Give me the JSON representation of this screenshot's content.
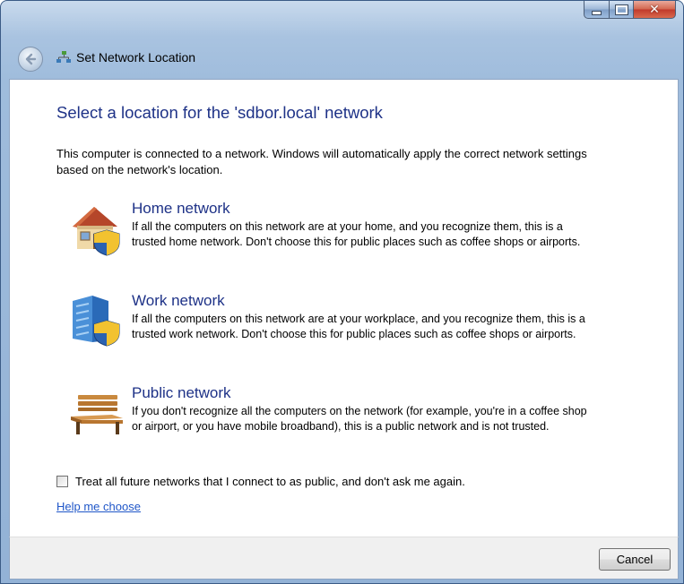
{
  "window": {
    "title": "Set Network Location",
    "caption_buttons": {
      "minimize": "minimize-icon",
      "maximize": "maximize-icon",
      "close": "close-icon"
    }
  },
  "heading": "Select a location for the 'sdbor.local' network",
  "intro": "This computer is connected to a network. Windows will automatically apply the correct network settings based on the network's location.",
  "options": [
    {
      "title": "Home network",
      "description": "If all the computers on this network are at your home, and you recognize them, this is a trusted home network.  Don't choose this for public places such as coffee shops or airports.",
      "icon": "home-network-icon"
    },
    {
      "title": "Work network",
      "description": "If all the computers on this network are at your workplace, and you recognize them, this is a trusted work network.  Don't choose this for public places such as coffee shops or airports.",
      "icon": "work-network-icon"
    },
    {
      "title": "Public network",
      "description": "If you don't recognize all the computers on the network (for example, you're in a coffee shop or airport, or you have mobile broadband), this is a public network and is not trusted.",
      "icon": "public-network-icon"
    }
  ],
  "checkbox": {
    "label": "Treat all future networks that I connect to as public, and don't ask me again.",
    "checked": false
  },
  "help_link": "Help me choose",
  "footer": {
    "cancel_label": "Cancel"
  },
  "colors": {
    "heading": "#1e3287",
    "link": "#1f56c8",
    "frame": "#a9c3e0"
  }
}
